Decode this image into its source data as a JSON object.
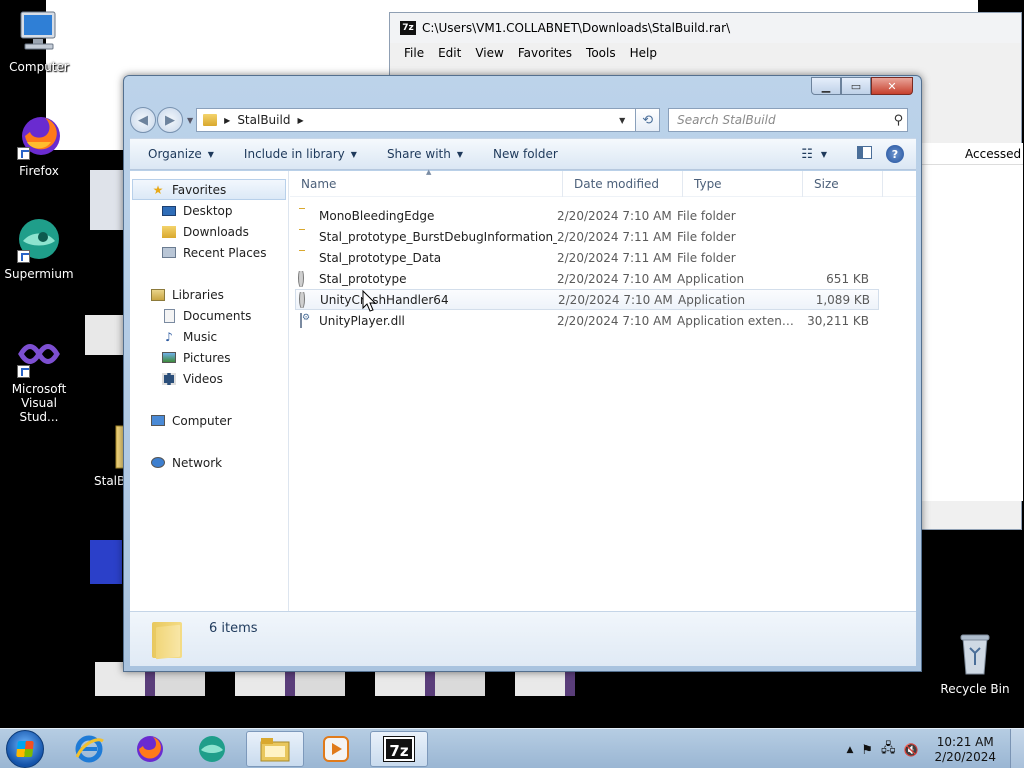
{
  "desktop": {
    "icons": [
      {
        "label": "Computer"
      },
      {
        "label": "Firefox"
      },
      {
        "label": "Supermium"
      },
      {
        "label": "Microsoft Visual Stud..."
      },
      {
        "label": "StalBu"
      },
      {
        "label": "Recycle Bin"
      }
    ]
  },
  "zip_window": {
    "title": "C:\\Users\\VM1.COLLABNET\\Downloads\\StalBuild.rar\\",
    "menu": [
      "File",
      "Edit",
      "View",
      "Favorites",
      "Tools",
      "Help"
    ],
    "column_accessed": "Accessed"
  },
  "explorer": {
    "address": {
      "crumb": "StalBuild"
    },
    "search": {
      "placeholder": "Search StalBuild"
    },
    "commands": {
      "organize": "Organize",
      "include_in_library": "Include in library",
      "share_with": "Share with",
      "new_folder": "New folder"
    },
    "nav": {
      "favorites": "Favorites",
      "desktop": "Desktop",
      "downloads": "Downloads",
      "recent_places": "Recent Places",
      "libraries": "Libraries",
      "documents": "Documents",
      "music": "Music",
      "pictures": "Pictures",
      "videos": "Videos",
      "computer": "Computer",
      "network": "Network"
    },
    "columns": {
      "name": "Name",
      "date": "Date modified",
      "type": "Type",
      "size": "Size"
    },
    "files": [
      {
        "name": "MonoBleedingEdge",
        "date": "2/20/2024 7:10 AM",
        "type": "File folder",
        "size": ""
      },
      {
        "name": "Stal_prototype_BurstDebugInformation_...",
        "date": "2/20/2024 7:11 AM",
        "type": "File folder",
        "size": ""
      },
      {
        "name": "Stal_prototype_Data",
        "date": "2/20/2024 7:11 AM",
        "type": "File folder",
        "size": ""
      },
      {
        "name": "Stal_prototype",
        "date": "2/20/2024 7:10 AM",
        "type": "Application",
        "size": "651 KB"
      },
      {
        "name": "UnityCrashHandler64",
        "date": "2/20/2024 7:10 AM",
        "type": "Application",
        "size": "1,089 KB"
      },
      {
        "name": "UnityPlayer.dll",
        "date": "2/20/2024 7:10 AM",
        "type": "Application extens...",
        "size": "30,211 KB"
      }
    ],
    "status": {
      "items": "6 items"
    }
  },
  "taskbar": {
    "clock_time": "10:21 AM",
    "clock_date": "2/20/2024",
    "zip_label": "7z"
  }
}
